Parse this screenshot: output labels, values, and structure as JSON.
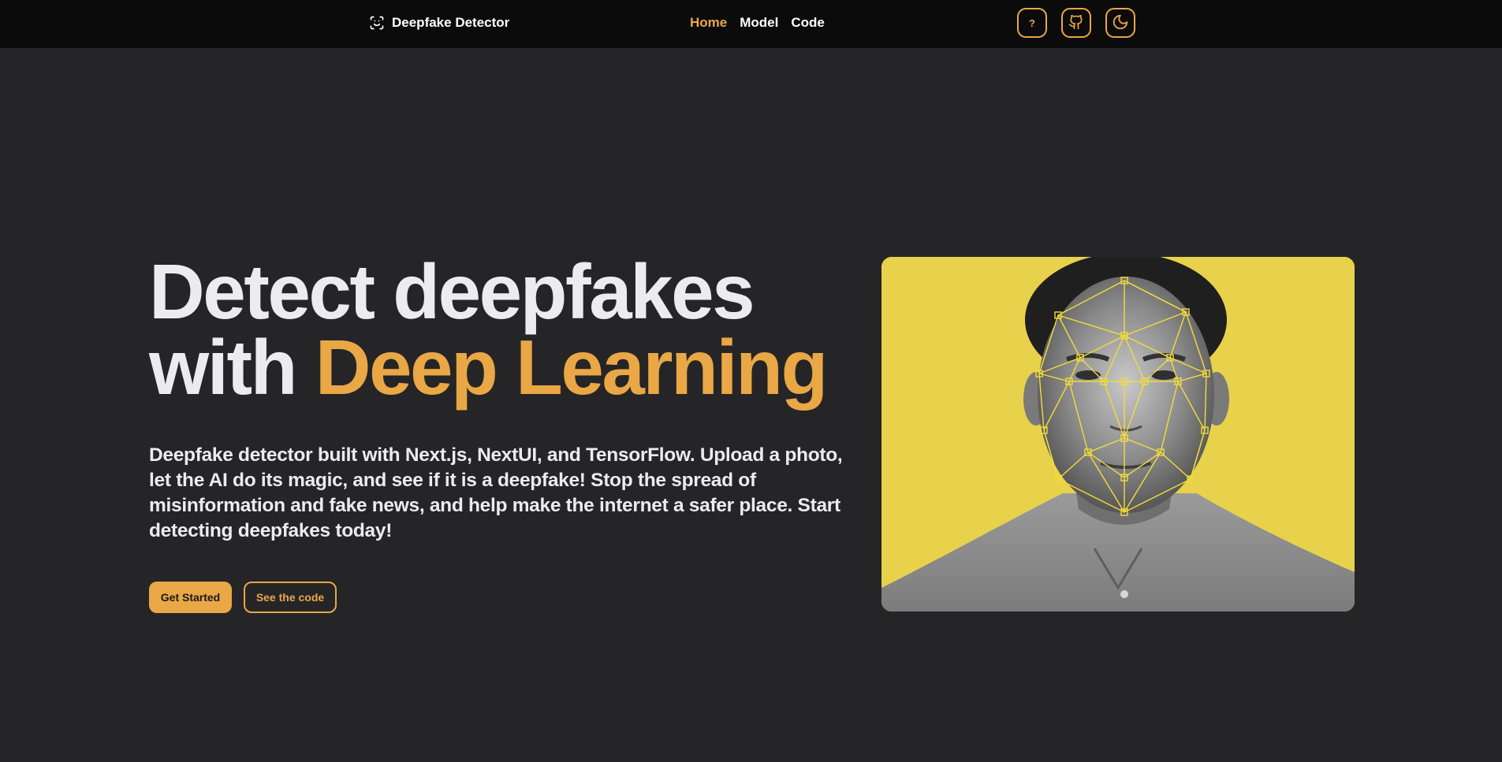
{
  "navbar": {
    "brand": {
      "icon": "scan-face-icon",
      "label": "Deepfake Detector"
    },
    "links": [
      {
        "label": "Home",
        "active": true
      },
      {
        "label": "Model",
        "active": false
      },
      {
        "label": "Code",
        "active": false
      }
    ],
    "actions": [
      {
        "icon": "help-icon",
        "label": "?"
      },
      {
        "icon": "github-icon"
      },
      {
        "icon": "moon-icon"
      }
    ]
  },
  "hero": {
    "title_part1": "Detect deepfakes",
    "title_part2": "with ",
    "title_accent": "Deep Learning",
    "description": "Deepfake detector built with Next.js, NextUI, and TensorFlow. Upload a photo, let the AI do its magic, and see if it is a deepfake! Stop the spread of misinformation and fake news, and help make the internet a safer place. Start detecting deepfakes today!",
    "primary_button": "Get Started",
    "secondary_button": "See the code",
    "image": {
      "subject": "face-mesh-portrait",
      "background_color": "#e8d24b"
    }
  },
  "colors": {
    "accent": "#e9a746",
    "background": "#252527",
    "navbar": "#0b0b0c",
    "text": "#ececee"
  }
}
